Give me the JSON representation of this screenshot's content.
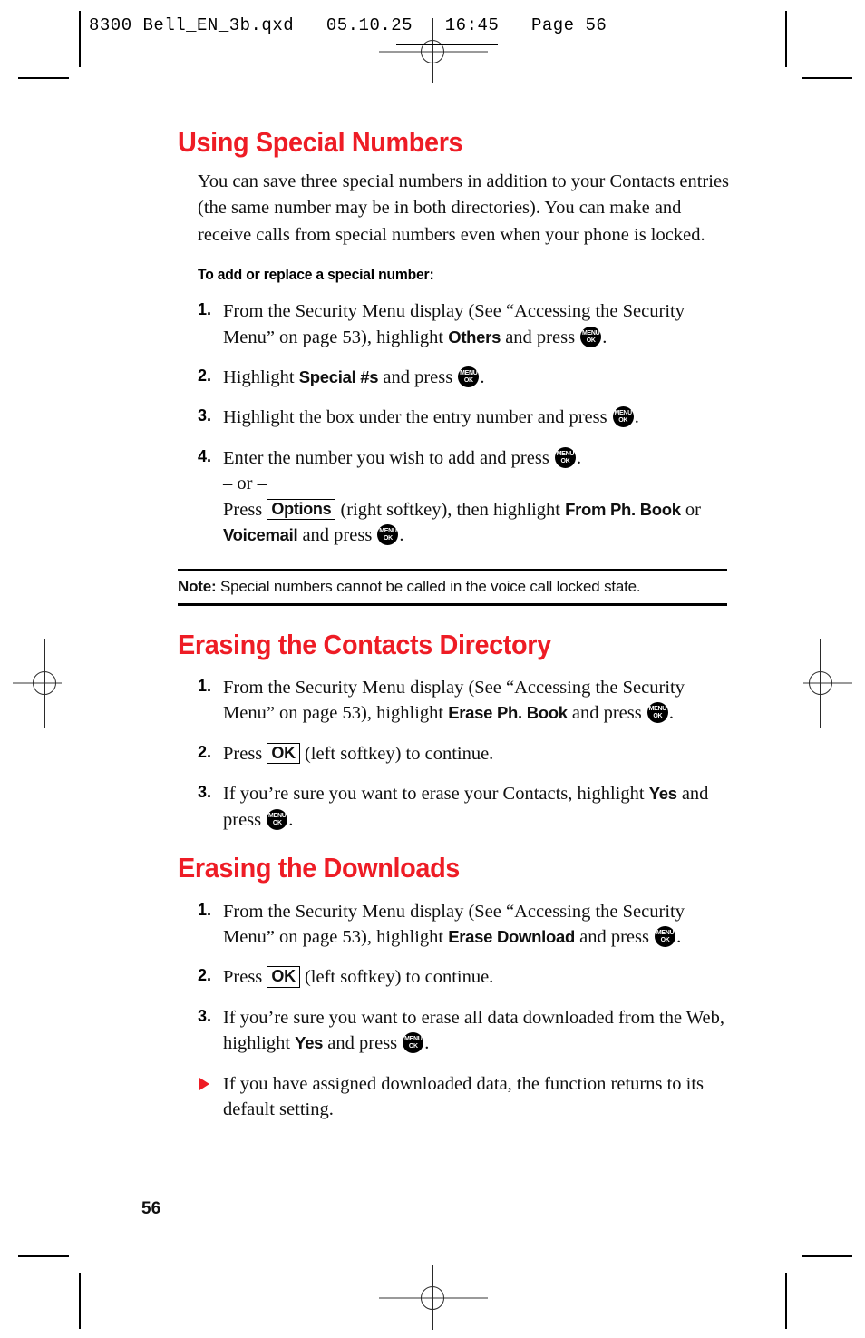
{
  "printer": {
    "slug": "8300 Bell_EN_3b.qxd   05.10.25   16:45   Page 56",
    "folio": "56",
    "accent_red": "#ee1c25"
  },
  "sections": [
    {
      "id": "using-special-numbers",
      "heading": "Using Special Numbers",
      "paragraph": "You can save three special numbers in addition to your Contacts entries (the same number may be in both directories). You can make and receive calls from special numbers even when your phone is locked.",
      "subhead": "To add or replace a special number:",
      "steps": [
        {
          "num": "1.",
          "pre": "From the Security Menu display (See “Accessing the Security Menu” on page 53), highlight ",
          "ui": "Others",
          "post": " and press ",
          "key": "menu-ok",
          "end": "."
        },
        {
          "num": "2.",
          "pre": "Highlight ",
          "ui": "Special #s",
          "post": " and press ",
          "key": "menu-ok",
          "end": "."
        },
        {
          "num": "3.",
          "pre": "Highlight the box under the entry number and press ",
          "ui": "",
          "post": "",
          "key": "menu-ok",
          "end": "."
        },
        {
          "num": "4.",
          "pre": "Enter the number you wish to add and press ",
          "ui": "",
          "post": "",
          "key": "menu-ok",
          "end": ".",
          "or_label": "– or –",
          "alt_pre": "Press ",
          "alt_softkey": "Options",
          "alt_mid": " (right softkey), then highlight ",
          "alt_ui1": "From Ph. Book",
          "alt_join": " or ",
          "alt_ui2": "Voicemail",
          "alt_post": " and press ",
          "alt_end": "."
        }
      ],
      "note": {
        "label": "Note:",
        "text": " Special numbers cannot be called in the voice call locked state."
      }
    },
    {
      "id": "erasing-the-contacts-directory",
      "heading": "Erasing the Contacts Directory",
      "steps": [
        {
          "num": "1.",
          "pre": "From the Security Menu display (See “Accessing the Security Menu” on page 53), highlight ",
          "ui": "Erase Ph. Book",
          "post": " and press ",
          "key": "menu-ok",
          "end": "."
        },
        {
          "num": "2.",
          "pre": "Press ",
          "softkey": "OK",
          "post": " (left softkey) to continue."
        },
        {
          "num": "3.",
          "pre": "If you’re sure you want to erase your Contacts, highlight ",
          "ui": "Yes",
          "post": " and press ",
          "key": "menu-ok",
          "end": "."
        }
      ]
    },
    {
      "id": "erasing-the-downloads",
      "heading": "Erasing the Downloads",
      "steps": [
        {
          "num": "1.",
          "pre": "From the Security Menu display (See “Accessing the Security Menu” on page 53), highlight ",
          "ui": "Erase Download",
          "post": " and press ",
          "key": "menu-ok",
          "end": "."
        },
        {
          "num": "2.",
          "pre": "Press ",
          "softkey": "OK",
          "post": " (left softkey) to continue."
        },
        {
          "num": "3.",
          "pre": "If you’re sure you want to erase all data downloaded from the Web, highlight ",
          "ui": "Yes",
          "post": " and press ",
          "key": "menu-ok",
          "end": "."
        },
        {
          "num": "▶",
          "bullet": true,
          "pre": "If you have assigned downloaded data, the function returns to its default setting."
        }
      ]
    }
  ],
  "icons": {
    "menu_ok_top": "MENU",
    "menu_ok_bottom": "OK"
  }
}
